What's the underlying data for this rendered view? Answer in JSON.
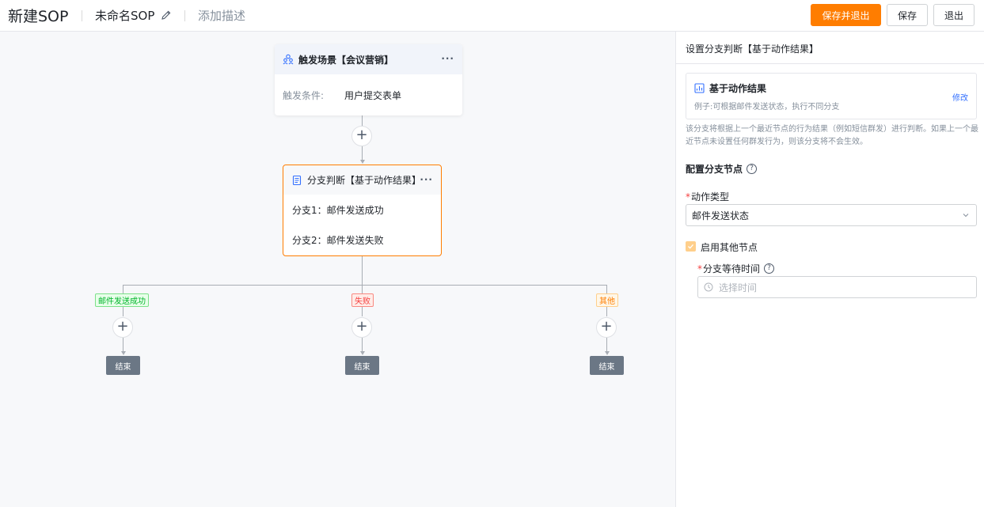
{
  "header": {
    "app_title": "新建SOP",
    "doc_name": "未命名SOP",
    "description_placeholder": "添加描述",
    "save_exit_label": "保存并退出",
    "save_label": "保存",
    "exit_label": "退出"
  },
  "canvas": {
    "trigger_node": {
      "title": "触发场景【会议营销】",
      "condition_label": "触发条件:",
      "condition_value": "用户提交表单"
    },
    "branch_node": {
      "title": "分支判断【基于动作结果】",
      "branches": [
        "分支1：邮件发送成功",
        "分支2：邮件发送失败"
      ]
    },
    "branch_tags": [
      "邮件发送成功",
      "失败",
      "其他"
    ],
    "end_label": "结束"
  },
  "panel": {
    "title": "设置分支判断【基于动作结果】",
    "card_title": "基于动作结果",
    "card_subtitle": "例子:可根据邮件发送状态，执行不同分支",
    "card_link": "修改",
    "hint": "该分支将根据上一个最近节点的行为结果（例如短信群发）进行判断。如果上一个最近节点未设置任何群发行为，则该分支将不会生效。",
    "section_title": "配置分支节点",
    "action_type_label": "动作类型",
    "action_type_value": "邮件发送状态",
    "enable_other_label": "启用其他节点",
    "enable_other_checked": true,
    "wait_time_label": "分支等待时间",
    "wait_time_placeholder": "选择时间"
  },
  "colors": {
    "accent": "#ff7d00",
    "link": "#3370ff",
    "end_node": "#6b7785"
  }
}
